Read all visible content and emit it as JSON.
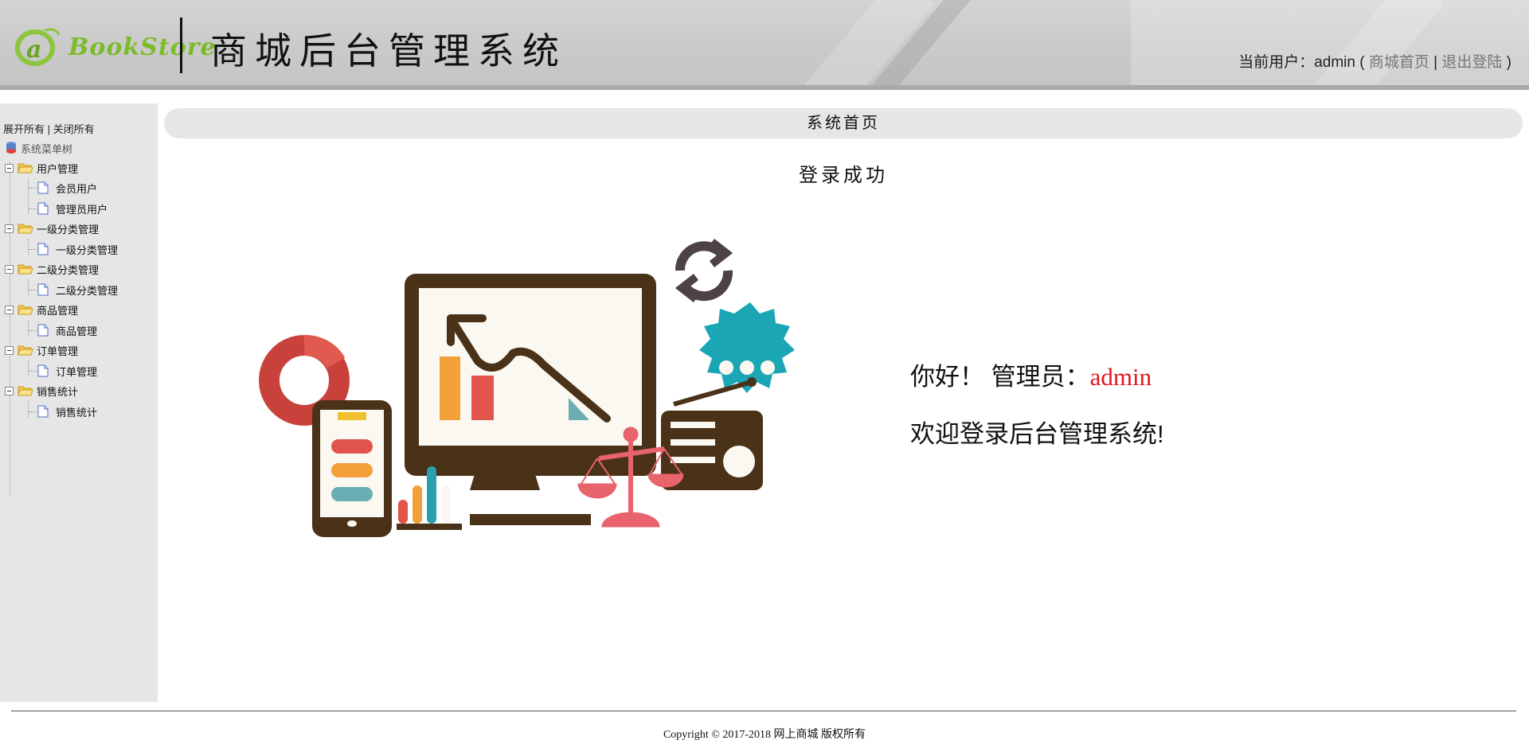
{
  "header": {
    "logo_text": "BookStore",
    "system_title": "商城后台管理系统",
    "current_user_label": "当前用户：",
    "current_user": "admin",
    "open_paren": " ( ",
    "home_link": "商城首页",
    "separator": " | ",
    "logout_link": "退出登陆",
    "close_paren": " )"
  },
  "sidebar": {
    "expand_all": "展开所有",
    "toolbar_sep": " | ",
    "collapse_all": "关闭所有",
    "root": "系统菜单树",
    "groups": [
      {
        "label": "用户管理",
        "children": [
          "会员用户",
          "管理员用户"
        ]
      },
      {
        "label": "一级分类管理",
        "children": [
          "一级分类管理"
        ]
      },
      {
        "label": "二级分类管理",
        "children": [
          "二级分类管理"
        ]
      },
      {
        "label": "商品管理",
        "children": [
          "商品管理"
        ]
      },
      {
        "label": "订单管理",
        "children": [
          "订单管理"
        ]
      },
      {
        "label": "销售统计",
        "children": [
          "销售统计"
        ]
      }
    ]
  },
  "main": {
    "breadcrumb": "系统首页",
    "login_message": "登录成功",
    "greeting_prefix": "你好！ 管理员：",
    "greeting_user": "admin",
    "welcome": "欢迎登录后台管理系统!"
  },
  "footer": {
    "copyright": "Copyright © 2017-2018 网上商城 版权所有"
  },
  "colors": {
    "accent_red": "#e0141e",
    "logo_green": "#7cbb2a",
    "panel_gray": "#e6e6e6"
  }
}
